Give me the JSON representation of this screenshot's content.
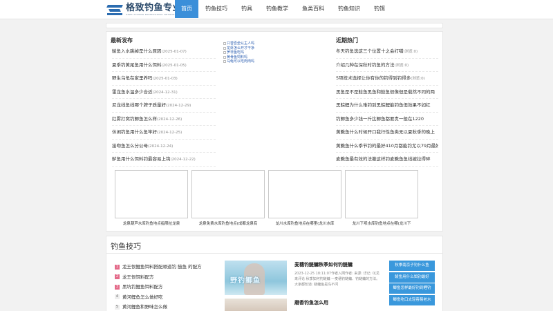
{
  "logo": {
    "text": "格致钓鱼专业网",
    "subtext": "GEZHI FISHING PROFESSIONAL NETWORK"
  },
  "nav": [
    {
      "label": "首页",
      "active": true
    },
    {
      "label": "钓鱼技巧"
    },
    {
      "label": "钓具"
    },
    {
      "label": "钓鱼教学"
    },
    {
      "label": "鱼类百科"
    },
    {
      "label": "钓鱼知识"
    },
    {
      "label": "钓饵"
    }
  ],
  "latest": {
    "title": "最新发布",
    "items": [
      {
        "text": "鲮鱼入水跳掉是什么原因",
        "date": "(2025-01-07)"
      },
      {
        "text": "夏季钓黄尾鱼用什么饵料",
        "date": "(2025-01-05)"
      },
      {
        "text": "野生乌龟在家里养吗",
        "date": "(2025-01-03)"
      },
      {
        "text": "雷龙鱼水温多少合适",
        "date": "(2024-12-31)"
      },
      {
        "text": "尼龙线鱼线哪个牌子质量好",
        "date": "(2024-12-29)"
      },
      {
        "text": "红雾打窝钓鲫鱼怎么样",
        "date": "(2024-12-26)"
      },
      {
        "text": "休闲钓鱼用什么鱼竿好",
        "date": "(2024-12-25)"
      },
      {
        "text": "接吻鱼怎么分公母",
        "date": "(2024-12-24)"
      },
      {
        "text": "鲈鱼用什么饵料钓最容易上钩",
        "date": "(2024-12-22)"
      }
    ]
  },
  "mid_links": [
    "只替否坐认主人吗",
    "龙虾怎么开才干净",
    "罗非鱼吃吗",
    "黄骨鱼饲料吗",
    "乌龟可以吃肉肉吗"
  ],
  "hot": {
    "title": "近期热门",
    "items": [
      {
        "text": "冬天钓鱼选这三个位置十之会打噹",
        "note": "(浏览:0)"
      },
      {
        "text": "介绍几种在深秋时钓鱼的方法",
        "note": "(浏览:0)"
      },
      {
        "text": "5项技术选择让你有你的钓得到钓得多",
        "note": "(浏览:0)"
      },
      {
        "text": "黑鱼是不是鲶鱼黑鱼和鲶鱼很像但是载然不同的两",
        "note": ""
      },
      {
        "text": "黑鲩鲤为什么难钓到黑鲩鲤能钓鱼但效果不如红",
        "note": ""
      },
      {
        "text": "钓鲫鱼多少钱一斤比鲫鱼都要贵一般在1220",
        "note": ""
      },
      {
        "text": "黄鳅鱼什么时候开口我行性鱼类无以夏秋季的晚上",
        "note": ""
      },
      {
        "text": "黄鳅鱼什么季节钓的最好410月都能钓尤以79月最好",
        "note": ""
      },
      {
        "text": "麦鳅鱼最有效的法撤这样钓麦鳅鱼鱼线被拉得碎",
        "note": ""
      }
    ]
  },
  "thumbs": [
    "龙泉葫芦水库钓鱼地点指限拉龙泉",
    "龙泉免费水库钓鱼地点(成都龙泉有",
    "龙川水库钓鱼地点在哪里(龙川水库",
    "龙川下坝水库钓鱼地点在哪(龙川下"
  ],
  "section2": {
    "title": "钓鱼技巧",
    "list": [
      {
        "num": "1",
        "text": "龙王恨鲤鱼饵料搭配顺道钓 鲢鱼 的配方"
      },
      {
        "num": "2",
        "text": "龙王恨饵料配方"
      },
      {
        "num": "3",
        "text": "黑坑钓鲤鱼饵料配方"
      },
      {
        "num": "4",
        "text": "黄河鲤鱼怎么做好吃"
      },
      {
        "num": "5",
        "text": "黄河鲤鱼和野味怎么做"
      }
    ],
    "feature_image_text": "野钓鲫鱼",
    "feature1": {
      "title": "麦穗钓鲢鳙秋季如何钓鲢鳙",
      "desc": "2023-12-25 18:11:07作者入网作者: 来源: 详记: 0[见来评论 秋季如何钓鲢鳙 一麦穗钓鲢鳙、钓鲢鳙的方法。大家都知道: 鲢鳙鱼是鸟不问"
    },
    "feature2": {
      "title": "磨香钓鱼怎么用",
      "desc": ""
    },
    "tags": [
      "秋季南京子钓什么鱼",
      "鲮鱼用什么饵钓最好",
      "鲫鱼怎样最好钓到鲤钓",
      "鲫鱼吃口太轻容易老水"
    ]
  }
}
